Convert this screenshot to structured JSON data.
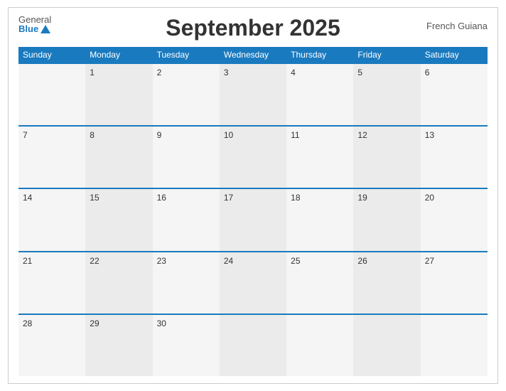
{
  "header": {
    "title": "September 2025",
    "country": "French Guiana",
    "logo_general": "General",
    "logo_blue": "Blue"
  },
  "dayHeaders": [
    "Sunday",
    "Monday",
    "Tuesday",
    "Wednesday",
    "Thursday",
    "Friday",
    "Saturday"
  ],
  "weeks": [
    [
      {
        "day": "",
        "empty": true
      },
      {
        "day": "1"
      },
      {
        "day": "2"
      },
      {
        "day": "3"
      },
      {
        "day": "4"
      },
      {
        "day": "5"
      },
      {
        "day": "6"
      }
    ],
    [
      {
        "day": "7"
      },
      {
        "day": "8"
      },
      {
        "day": "9"
      },
      {
        "day": "10"
      },
      {
        "day": "11"
      },
      {
        "day": "12"
      },
      {
        "day": "13"
      }
    ],
    [
      {
        "day": "14"
      },
      {
        "day": "15"
      },
      {
        "day": "16"
      },
      {
        "day": "17"
      },
      {
        "day": "18"
      },
      {
        "day": "19"
      },
      {
        "day": "20"
      }
    ],
    [
      {
        "day": "21"
      },
      {
        "day": "22"
      },
      {
        "day": "23"
      },
      {
        "day": "24"
      },
      {
        "day": "25"
      },
      {
        "day": "26"
      },
      {
        "day": "27"
      }
    ],
    [
      {
        "day": "28"
      },
      {
        "day": "29"
      },
      {
        "day": "30"
      },
      {
        "day": "",
        "empty": true
      },
      {
        "day": "",
        "empty": true
      },
      {
        "day": "",
        "empty": true
      },
      {
        "day": "",
        "empty": true
      }
    ]
  ]
}
